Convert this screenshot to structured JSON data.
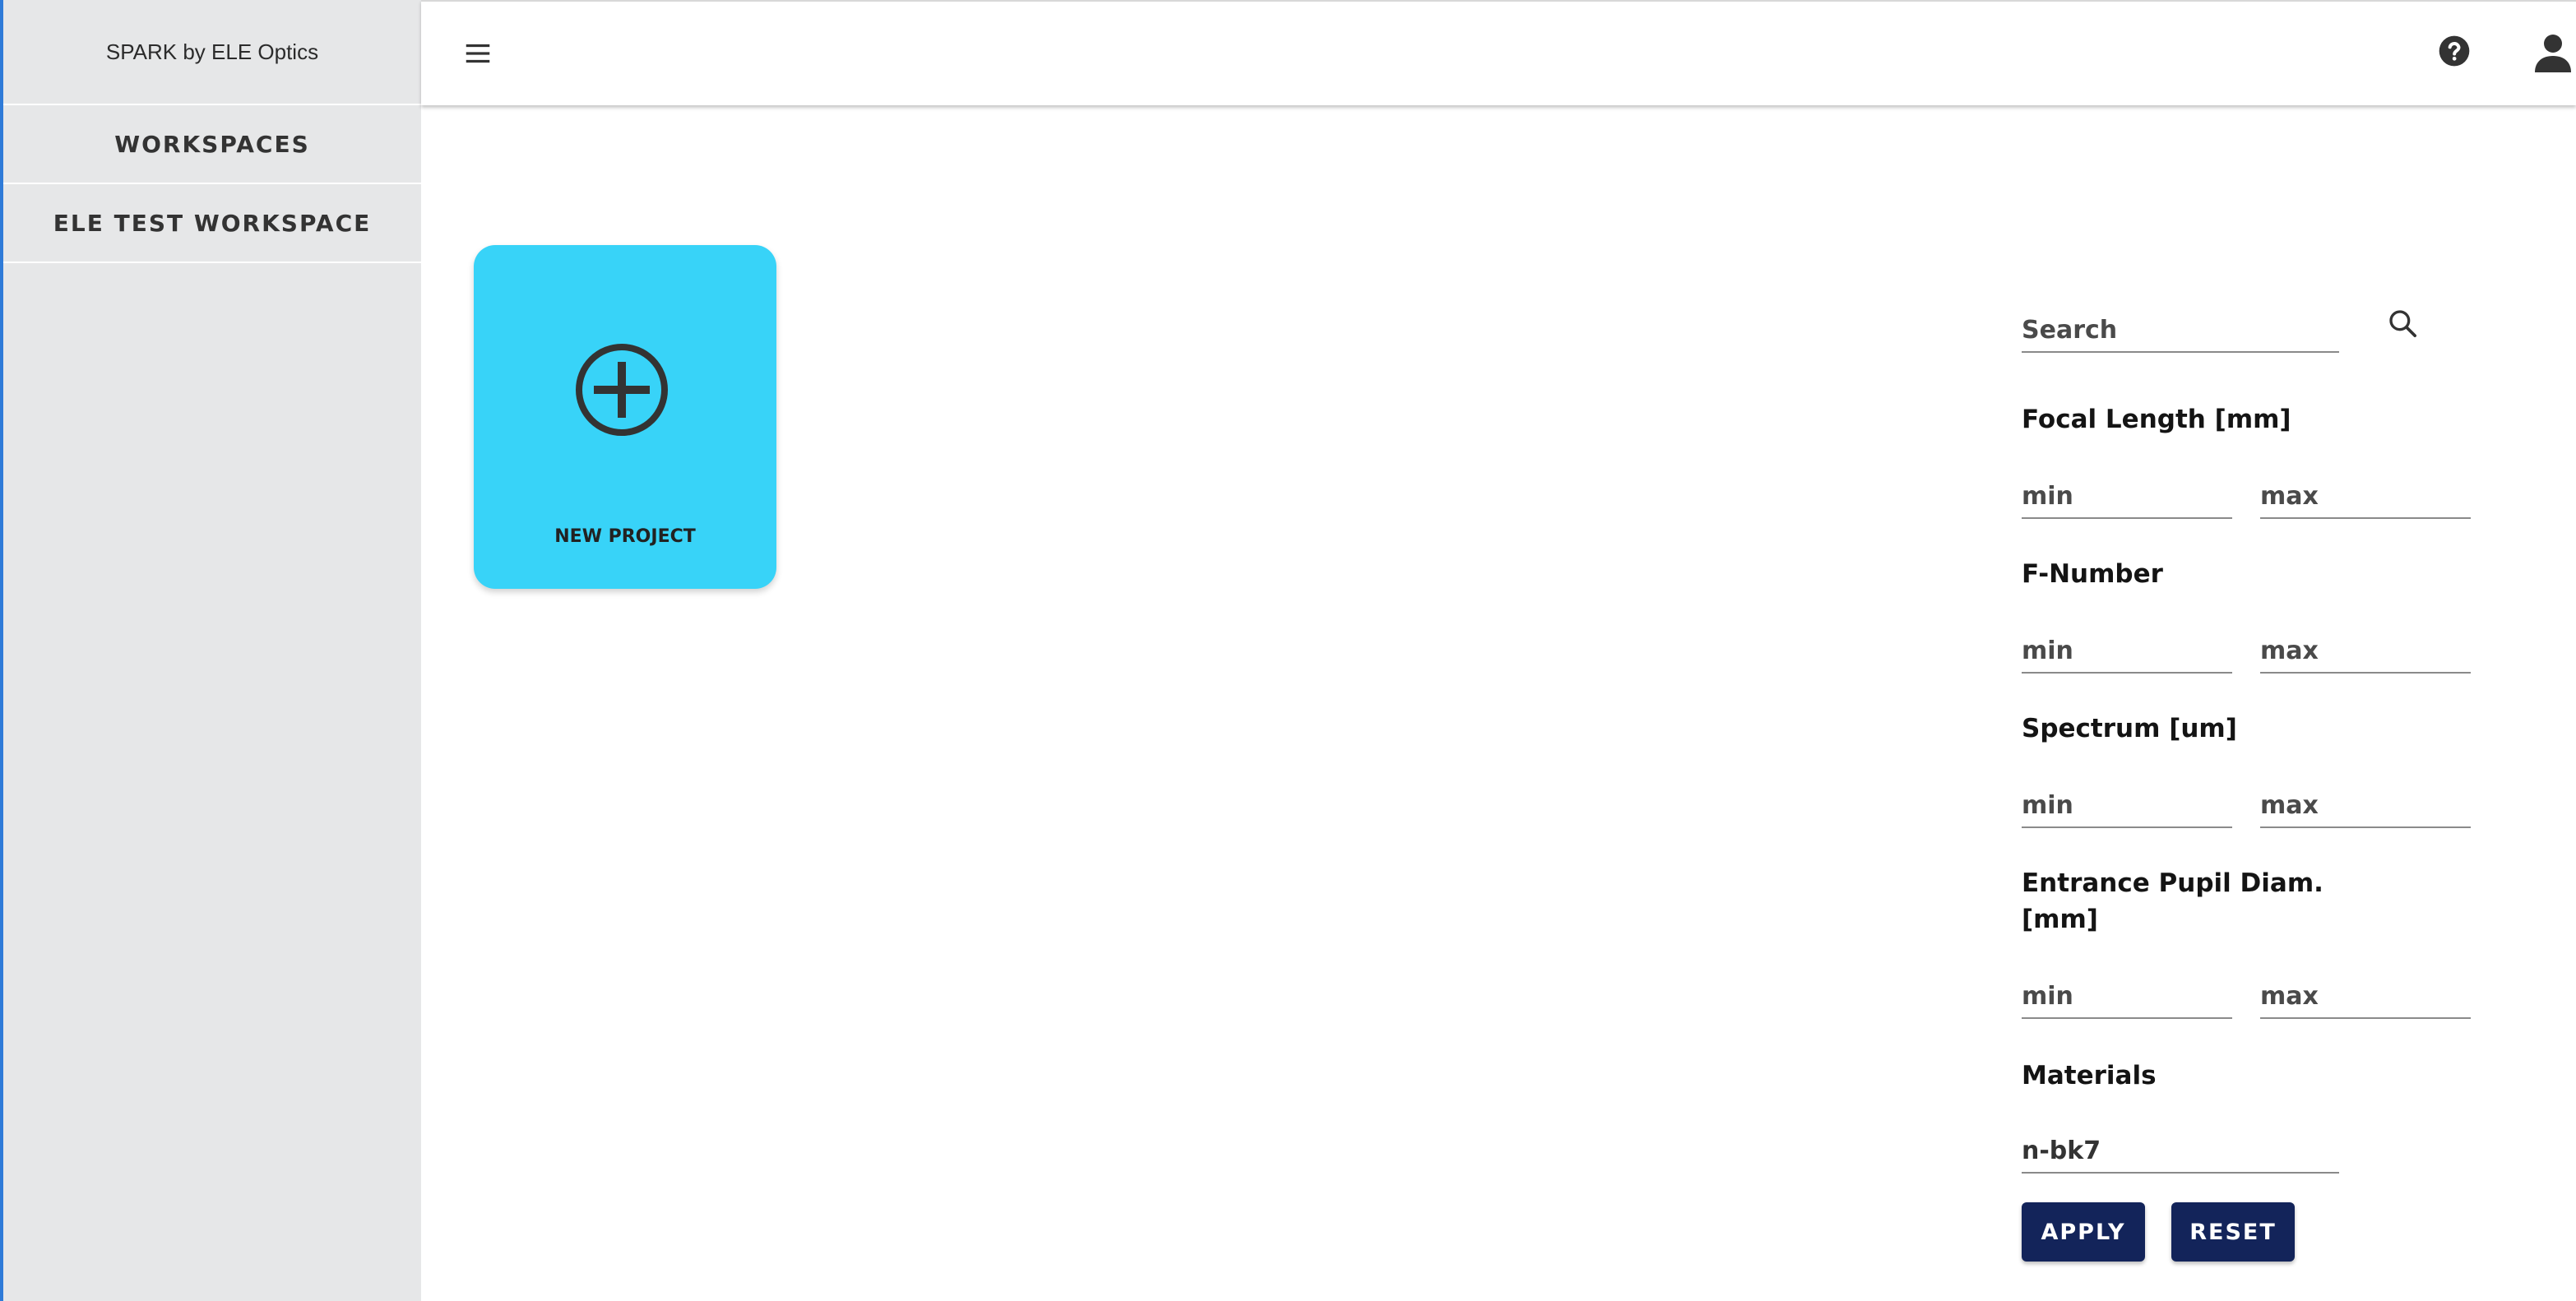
{
  "app": {
    "brand": "SPARK by ELE Optics"
  },
  "sidebar": {
    "items": [
      {
        "label": "WORKSPACES"
      },
      {
        "label": "ELE TEST WORKSPACE"
      }
    ]
  },
  "header": {
    "icons": [
      "menu-icon",
      "help-icon",
      "user-icon"
    ]
  },
  "main": {
    "new_project": {
      "label": "NEW PROJECT",
      "icon": "plus-circle-icon",
      "color": "#38d3f8"
    }
  },
  "filters": {
    "search": {
      "placeholder": "Search",
      "value": ""
    },
    "focal_length": {
      "label": "Focal Length [mm]",
      "min_placeholder": "min",
      "max_placeholder": "max"
    },
    "f_number": {
      "label": "F-Number",
      "min_placeholder": "min",
      "max_placeholder": "max"
    },
    "spectrum": {
      "label": "Spectrum [um]",
      "min_placeholder": "min",
      "max_placeholder": "max"
    },
    "entrance_pupil": {
      "label_line1": "Entrance Pupil Diam.",
      "label_line2": "[mm]",
      "min_placeholder": "min",
      "max_placeholder": "max"
    },
    "materials": {
      "label": "Materials",
      "value": "n-bk7"
    },
    "apply_label": "APPLY",
    "reset_label": "RESET",
    "button_color": "#13245a"
  }
}
